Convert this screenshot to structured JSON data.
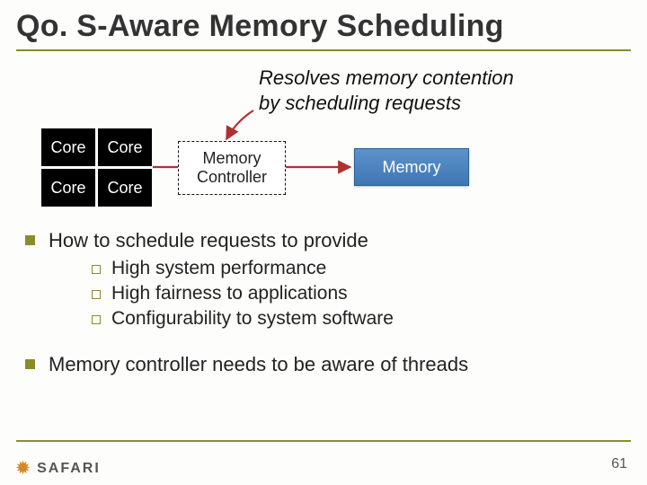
{
  "title": "Qo. S-Aware Memory Scheduling",
  "diagram": {
    "caption_l1": "Resolves memory contention",
    "caption_l2": "by scheduling requests",
    "core_label": "Core",
    "memctrl_l1": "Memory",
    "memctrl_l2": "Controller",
    "mem_label": "Memory"
  },
  "bullets": {
    "top1": "How to schedule requests to provide",
    "sub1": "High system performance",
    "sub2": "High fairness to applications",
    "sub3": "Configurability to system software",
    "top2": "Memory controller needs to be aware of threads"
  },
  "logo_text": "SAFARI",
  "page_number": "61"
}
